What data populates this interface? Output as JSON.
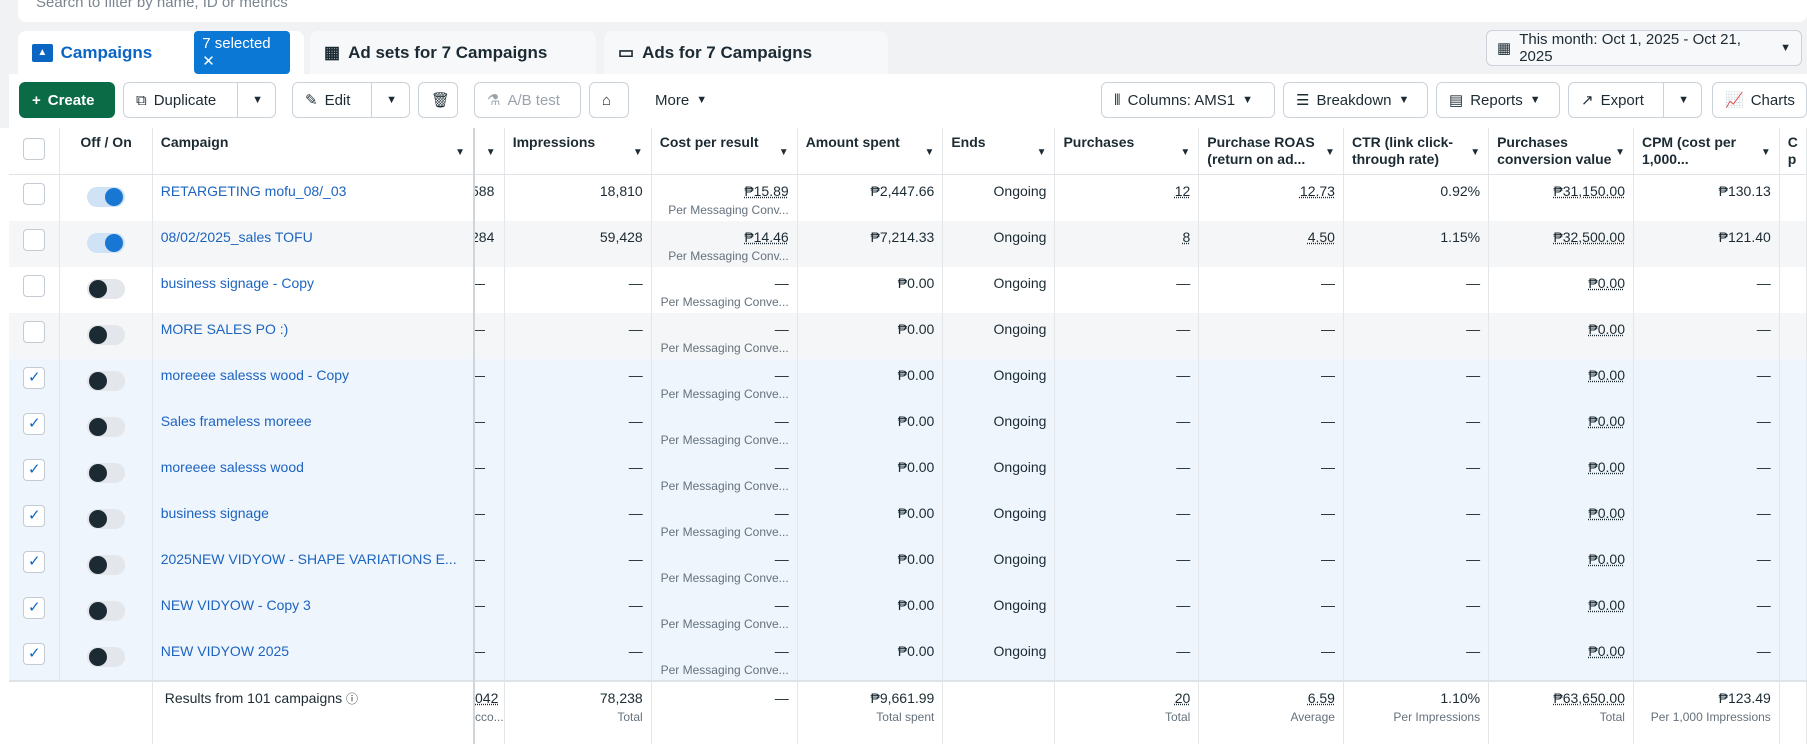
{
  "search": {
    "placeholder": "Search to filter by name, ID or metrics"
  },
  "tabs": [
    {
      "label": "Campaigns",
      "icon": "campaign-folder-icon"
    },
    {
      "label": "Ad sets for 7 Campaigns",
      "icon": "grid-icon"
    },
    {
      "label": "Ads for 7 Campaigns",
      "icon": "ad-window-icon"
    }
  ],
  "selection": {
    "label": "7 selected"
  },
  "date_range": "This month: Oct 1, 2025 - Oct 21, 2025",
  "toolbar": {
    "create": "Create",
    "duplicate": "Duplicate",
    "edit": "Edit",
    "ab_test": "A/B test",
    "more": "More",
    "columns": "Columns: AMS1",
    "breakdown": "Breakdown",
    "reports": "Reports",
    "export": "Export",
    "charts": "Charts"
  },
  "columns": [
    "Off / On",
    "Campaign",
    "",
    "Impressions",
    "Cost per result",
    "Amount spent",
    "Ends",
    "Purchases",
    "Purchase ROAS (return on ad...",
    "CTR (link click-through rate)",
    "Purchases conversion value",
    "CPM (cost per 1,000...",
    "C p"
  ],
  "rows": [
    {
      "name": "RETARGETING mofu_08/_03",
      "on": true,
      "checked": false,
      "partial": "588",
      "impressions": "18,810",
      "cpr": "₱15.89",
      "cpr_sub": "Per Messaging Conv...",
      "spent": "₱2,447.66",
      "ends": "Ongoing",
      "purchases": "12",
      "roas": "12.73",
      "ctr": "0.92%",
      "pcv": "₱31,150.00",
      "cpm": "₱130.13"
    },
    {
      "name": "08/02/2025_sales TOFU",
      "on": true,
      "checked": false,
      "partial": "284",
      "impressions": "59,428",
      "cpr": "₱14.46",
      "cpr_sub": "Per Messaging Conv...",
      "spent": "₱7,214.33",
      "ends": "Ongoing",
      "purchases": "8",
      "roas": "4.50",
      "ctr": "1.15%",
      "pcv": "₱32,500.00",
      "cpm": "₱121.40"
    },
    {
      "name": "business signage - Copy",
      "on": false,
      "checked": false,
      "partial": "—",
      "impressions": "—",
      "cpr": "—",
      "cpr_sub": "Per Messaging Conve...",
      "spent": "₱0.00",
      "ends": "Ongoing",
      "purchases": "—",
      "roas": "—",
      "ctr": "—",
      "pcv": "₱0.00",
      "cpm": "—"
    },
    {
      "name": "MORE SALES PO :)",
      "on": false,
      "checked": false,
      "partial": "—",
      "impressions": "—",
      "cpr": "—",
      "cpr_sub": "Per Messaging Conve...",
      "spent": "₱0.00",
      "ends": "Ongoing",
      "purchases": "—",
      "roas": "—",
      "ctr": "—",
      "pcv": "₱0.00",
      "cpm": "—"
    },
    {
      "name": "moreeee salesss wood - Copy",
      "on": false,
      "checked": true,
      "partial": "—",
      "impressions": "—",
      "cpr": "—",
      "cpr_sub": "Per Messaging Conve...",
      "spent": "₱0.00",
      "ends": "Ongoing",
      "purchases": "—",
      "roas": "—",
      "ctr": "—",
      "pcv": "₱0.00",
      "cpm": "—"
    },
    {
      "name": "Sales frameless moreee",
      "on": false,
      "checked": true,
      "partial": "—",
      "impressions": "—",
      "cpr": "—",
      "cpr_sub": "Per Messaging Conve...",
      "spent": "₱0.00",
      "ends": "Ongoing",
      "purchases": "—",
      "roas": "—",
      "ctr": "—",
      "pcv": "₱0.00",
      "cpm": "—"
    },
    {
      "name": "moreeee salesss wood",
      "on": false,
      "checked": true,
      "partial": "—",
      "impressions": "—",
      "cpr": "—",
      "cpr_sub": "Per Messaging Conve...",
      "spent": "₱0.00",
      "ends": "Ongoing",
      "purchases": "—",
      "roas": "—",
      "ctr": "—",
      "pcv": "₱0.00",
      "cpm": "—"
    },
    {
      "name": "business signage",
      "on": false,
      "checked": true,
      "partial": "—",
      "impressions": "—",
      "cpr": "—",
      "cpr_sub": "Per Messaging Conve...",
      "spent": "₱0.00",
      "ends": "Ongoing",
      "purchases": "—",
      "roas": "—",
      "ctr": "—",
      "pcv": "₱0.00",
      "cpm": "—"
    },
    {
      "name": "2025NEW VIDYOW - SHAPE VARIATIONS E...",
      "on": false,
      "checked": true,
      "partial": "—",
      "impressions": "—",
      "cpr": "—",
      "cpr_sub": "Per Messaging Conve...",
      "spent": "₱0.00",
      "ends": "Ongoing",
      "purchases": "—",
      "roas": "—",
      "ctr": "—",
      "pcv": "₱0.00",
      "cpm": "—"
    },
    {
      "name": "NEW VIDYOW - Copy 3",
      "on": false,
      "checked": true,
      "partial": "—",
      "impressions": "—",
      "cpr": "—",
      "cpr_sub": "Per Messaging Conve...",
      "spent": "₱0.00",
      "ends": "Ongoing",
      "purchases": "—",
      "roas": "—",
      "ctr": "—",
      "pcv": "₱0.00",
      "cpm": "—"
    },
    {
      "name": "NEW VIDYOW 2025",
      "on": false,
      "checked": true,
      "partial": "—",
      "impressions": "—",
      "cpr": "—",
      "cpr_sub": "Per Messaging Conve...",
      "spent": "₱0.00",
      "ends": "Ongoing",
      "purchases": "—",
      "roas": "—",
      "ctr": "—",
      "pcv": "₱0.00",
      "cpm": "—"
    }
  ],
  "footer": {
    "label": "Results from 101 campaigns",
    "partial": "042",
    "partial_sub": "cco...",
    "impressions": "78,238",
    "impressions_sub": "Total",
    "cpr": "—",
    "spent": "₱9,661.99",
    "spent_sub": "Total spent",
    "purchases": "20",
    "purchases_sub": "Total",
    "roas": "6.59",
    "roas_sub": "Average",
    "ctr": "1.10%",
    "ctr_sub": "Per Impressions",
    "pcv": "₱63,650.00",
    "pcv_sub": "Total",
    "cpm": "₱123.49",
    "cpm_sub": "Per 1,000 Impressions"
  },
  "colors": {
    "accent": "#0a66c2",
    "create": "#0b6b47",
    "selected_row": "#eef5fd"
  }
}
